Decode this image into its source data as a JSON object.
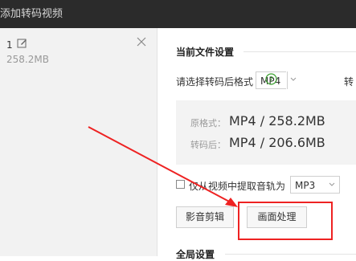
{
  "window": {
    "title": "添加转码视频"
  },
  "file_list": {
    "items": [
      {
        "index": "1",
        "size": "258.2MB"
      }
    ]
  },
  "current_settings": {
    "section_title": "当前文件设置",
    "format_label": "请选择转码后格式",
    "format_value": "MP4",
    "truncated_label": "转",
    "original": {
      "label": "原格式：",
      "value": "MP4  /  258.2MB"
    },
    "converted": {
      "label": "转码后：",
      "value": "MP4  /  206.6MB"
    },
    "extract_audio_label": "仅从视频中提取音轨为",
    "audio_format_value": "MP3",
    "audio_edit_button": "影音剪辑",
    "image_process_button": "画面处理"
  },
  "global_settings": {
    "section_title": "全局设置"
  },
  "annotation": {
    "color": "#ee2222"
  }
}
